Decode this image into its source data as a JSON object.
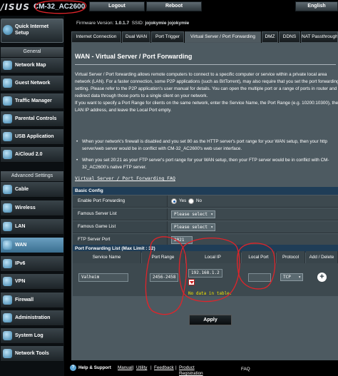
{
  "header": {
    "logo": "/ISUS",
    "model": "CM-32_AC2600",
    "logout_label": "Logout",
    "reboot_label": "Reboot",
    "language_label": "English",
    "firmware_label": "Firmware Version:",
    "firmware_value": "1.0.1.7",
    "ssid_label": "SSID:",
    "ssid_values": "jojokymie  jojokymie"
  },
  "sidebar": {
    "quick_internet_setup": "Quick Internet Setup",
    "general_label": "General",
    "general_items": [
      {
        "label": "Network Map"
      },
      {
        "label": "Guest Network"
      },
      {
        "label": "Traffic Manager"
      },
      {
        "label": "Parental Controls"
      },
      {
        "label": "USB Application"
      },
      {
        "label": "AiCloud 2.0"
      }
    ],
    "advanced_label": "Advanced Settings",
    "advanced_items": [
      {
        "label": "Cable"
      },
      {
        "label": "Wireless"
      },
      {
        "label": "LAN"
      },
      {
        "label": "WAN"
      },
      {
        "label": "IPv6"
      },
      {
        "label": "VPN"
      },
      {
        "label": "Firewall"
      },
      {
        "label": "Administration"
      },
      {
        "label": "System Log"
      },
      {
        "label": "Network Tools"
      }
    ],
    "active_item": "WAN"
  },
  "tabs": [
    {
      "label": "Internet Connection"
    },
    {
      "label": "Dual WAN"
    },
    {
      "label": "Port Trigger"
    },
    {
      "label": "Virtual Server / Port Forwarding"
    },
    {
      "label": "DMZ"
    },
    {
      "label": "DDNS"
    },
    {
      "label": "NAT Passthrough"
    }
  ],
  "active_tab": "Virtual Server / Port Forwarding",
  "page": {
    "title": "WAN - Virtual Server / Port Forwarding",
    "description": "Virtual Server / Port forwarding allows remote computers to connect to a specific computer or service within a private local area network (LAN). For a faster connection, some P2P applications (such as BitTorrent), may also require that you set the port forwarding setting. Please refer to the P2P application's user manual for details. You can open the multiple port or a range of ports in router and redirect data through those ports to a single client on your network.\nIf you want to specify a Port Range for clients on the same network, enter the Service Name, the Port Range (e.g. 10200:10300), the LAN IP address, and leave the Local Port empty.",
    "bullet1": "When your network's firewall is disabled and you set 80 as the HTTP server's port range for your WAN setup, then your http server/web server would be in conflict with CM-32_AC2600's web user interface.",
    "bullet2": "When you set 20:21 as your FTP server's port range for your WAN setup, then your FTP server would be in conflict with CM-32_AC2600's native FTP server.",
    "faq_link": "Virtual Server / Port Forwarding FAQ"
  },
  "basic_config": {
    "header": "Basic Config",
    "enable_label": "Enable Port Forwarding",
    "enable_yes": "Yes",
    "enable_no": "No",
    "enable_value": "Yes",
    "famous_server_label": "Famous Server List",
    "famous_server_value": "Please select",
    "famous_game_label": "Famous Game List",
    "famous_game_value": "Please select",
    "ftp_port_label": "FTP Server Port",
    "ftp_port_value": "2021"
  },
  "port_forwarding_list": {
    "header": "Port Forwarding List (Max Limit : 32)",
    "columns": [
      "Service Name",
      "Port Range",
      "Local IP",
      "Local Port",
      "Protocol",
      "Add / Delete"
    ],
    "input_row": {
      "service_name": "Valheim",
      "port_range": "2456-2458",
      "local_ip": "192.168.1.2",
      "local_port": "",
      "protocol": "TCP"
    },
    "empty_message": "No data in table."
  },
  "apply_label": "Apply",
  "footer": {
    "help_support": "Help & Support",
    "links": [
      "Manual",
      "Utility",
      "Feedback",
      "Product Registration"
    ],
    "faq": "FAQ"
  },
  "annotation_color": "#e0242a"
}
